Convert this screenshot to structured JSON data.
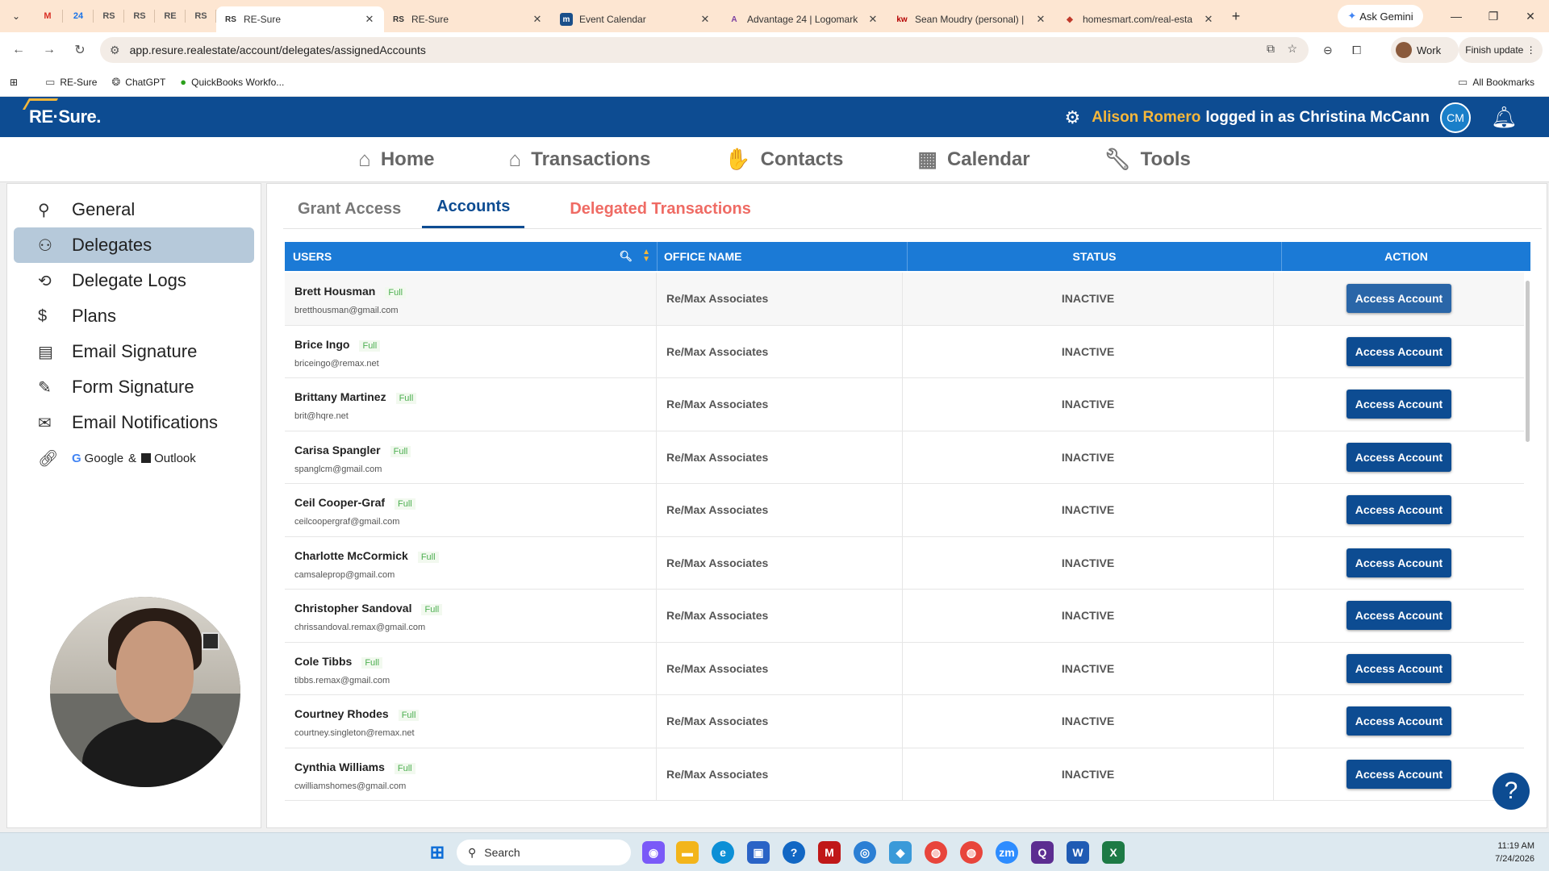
{
  "browser": {
    "pinned_tabs": [
      "M",
      "24",
      "RS",
      "RS",
      "RE",
      "RS"
    ],
    "tabs": [
      {
        "favicon": "RS",
        "title": "RE-Sure",
        "active": true
      },
      {
        "favicon": "RS",
        "title": "RE-Sure",
        "active": false
      },
      {
        "favicon": "m",
        "title": "Event Calendar",
        "active": false
      },
      {
        "favicon": "A",
        "title": "Advantage 24 | Logomark",
        "active": false
      },
      {
        "favicon": "kw",
        "title": "Sean Moudry (personal) |",
        "active": false
      },
      {
        "favicon": "◆",
        "title": "homesmart.com/real-esta",
        "active": false
      }
    ],
    "gemini_label": "Ask Gemini",
    "url": "app.resure.realestate/account/delegates/assignedAccounts",
    "profile_label": "Work",
    "finish_update_label": "Finish update",
    "bookmarks": [
      {
        "icon": "folder-icon",
        "label": "RE-Sure"
      },
      {
        "icon": "chatgpt-icon",
        "label": "ChatGPT"
      },
      {
        "icon": "quickbooks-icon",
        "label": "QuickBooks Workfo..."
      }
    ],
    "all_bookmarks_label": "All Bookmarks"
  },
  "app": {
    "logo_text": "RE·Sure.",
    "user_name": "Alison Romero",
    "logged_in_as": "logged in as Christina McCann",
    "avatar_initials": "CM"
  },
  "main_nav": [
    {
      "icon": "home-icon",
      "label": "Home"
    },
    {
      "icon": "transactions-icon",
      "label": "Transactions"
    },
    {
      "icon": "handshake-icon",
      "label": "Contacts"
    },
    {
      "icon": "calendar-icon",
      "label": "Calendar"
    },
    {
      "icon": "wrench-icon",
      "label": "Tools"
    }
  ],
  "sidebar": {
    "items": [
      {
        "icon": "person-icon",
        "label": "General",
        "active": false
      },
      {
        "icon": "delegates-icon",
        "label": "Delegates",
        "active": true
      },
      {
        "icon": "log-icon",
        "label": "Delegate Logs",
        "active": false
      },
      {
        "icon": "dollar-icon",
        "label": "Plans",
        "active": false
      },
      {
        "icon": "id-card-icon",
        "label": "Email Signature",
        "active": false
      },
      {
        "icon": "signature-icon",
        "label": "Form Signature",
        "active": false
      },
      {
        "icon": "envelope-icon",
        "label": "Email Notifications",
        "active": false
      }
    ],
    "integration": {
      "google": "Google",
      "and": "&",
      "outlook": "Outlook"
    }
  },
  "subtabs": [
    {
      "label": "Grant Access",
      "state": "default"
    },
    {
      "label": "Accounts",
      "state": "active"
    },
    {
      "label": "Delegated Transactions",
      "state": "highlight"
    }
  ],
  "table": {
    "headers": {
      "users": "USERS",
      "office": "OFFICE NAME",
      "status": "STATUS",
      "action": "ACTION"
    },
    "rows": [
      {
        "name": "Brett Housman",
        "badge": "Full",
        "email": "bretthousman@gmail.com",
        "office": "Re/Max Associates",
        "status": "INACTIVE",
        "action": "Access Account"
      },
      {
        "name": "Brice Ingo",
        "badge": "Full",
        "email": "briceingo@remax.net",
        "office": "Re/Max Associates",
        "status": "INACTIVE",
        "action": "Access Account"
      },
      {
        "name": "Brittany Martinez",
        "badge": "Full",
        "email": "brit@hqre.net",
        "office": "Re/Max Associates",
        "status": "INACTIVE",
        "action": "Access Account"
      },
      {
        "name": "Carisa Spangler",
        "badge": "Full",
        "email": "spanglcm@gmail.com",
        "office": "Re/Max Associates",
        "status": "INACTIVE",
        "action": "Access Account"
      },
      {
        "name": "Ceil Cooper-Graf",
        "badge": "Full",
        "email": "ceilcoopergraf@gmail.com",
        "office": "Re/Max Associates",
        "status": "INACTIVE",
        "action": "Access Account"
      },
      {
        "name": "Charlotte McCormick",
        "badge": "Full",
        "email": "camsaleprop@gmail.com",
        "office": "Re/Max Associates",
        "status": "INACTIVE",
        "action": "Access Account"
      },
      {
        "name": "Christopher Sandoval",
        "badge": "Full",
        "email": "chrissandoval.remax@gmail.com",
        "office": "Re/Max Associates",
        "status": "INACTIVE",
        "action": "Access Account"
      },
      {
        "name": "Cole Tibbs",
        "badge": "Full",
        "email": "tibbs.remax@gmail.com",
        "office": "Re/Max Associates",
        "status": "INACTIVE",
        "action": "Access Account"
      },
      {
        "name": "Courtney Rhodes",
        "badge": "Full",
        "email": "courtney.singleton@remax.net",
        "office": "Re/Max Associates",
        "status": "INACTIVE",
        "action": "Access Account"
      },
      {
        "name": "Cynthia Williams",
        "badge": "Full",
        "email": "cwilliamshomes@gmail.com",
        "office": "Re/Max Associates",
        "status": "INACTIVE",
        "action": "Access Account"
      }
    ]
  },
  "help_label": "?",
  "taskbar": {
    "search_label": "Search",
    "time": "11:19 AM",
    "date": "7/24/2026"
  }
}
